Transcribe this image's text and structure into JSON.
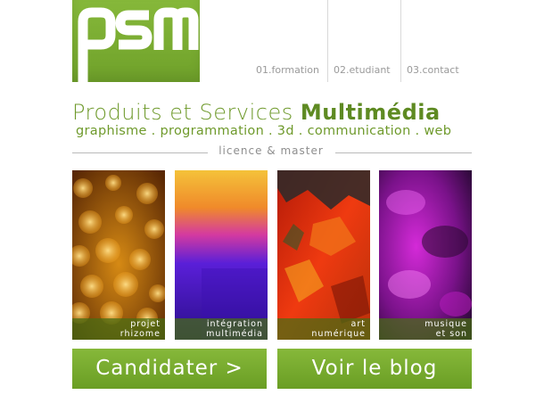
{
  "logo": {
    "text": "psm"
  },
  "nav": {
    "items": [
      {
        "label": "01.formation"
      },
      {
        "label": "02.etudiant"
      },
      {
        "label": "03.contact"
      }
    ]
  },
  "header": {
    "title_light": "Produits et Services",
    "title_bold": "Multimédia",
    "subtitle": "graphisme . programmation . 3d . communication . web",
    "tagline": "licence & master"
  },
  "cards": [
    {
      "line1": "projet",
      "line2": "rhizome"
    },
    {
      "line1": "intégration",
      "line2": "multimédia"
    },
    {
      "line1": "art",
      "line2": "numérique"
    },
    {
      "line1": "musique",
      "line2": "et son"
    }
  ],
  "buttons": {
    "apply": "Candidater >",
    "blog": "Voir le blog"
  },
  "colors": {
    "brand_green": "#7aaf32",
    "caption_bg": "#466e14"
  }
}
